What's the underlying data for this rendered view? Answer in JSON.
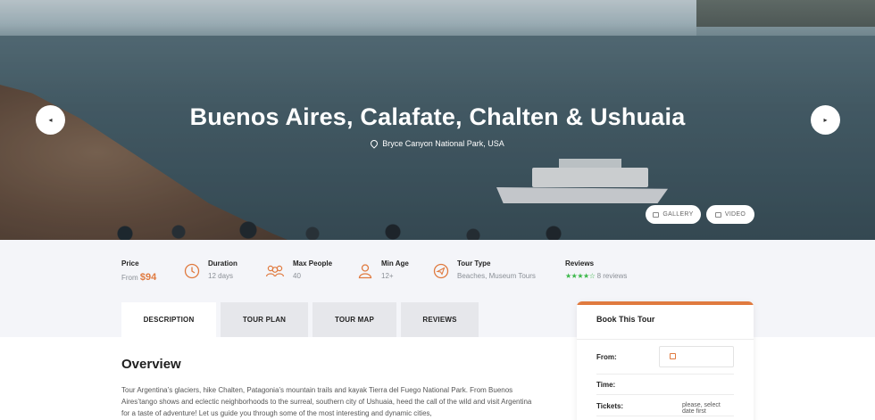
{
  "hero": {
    "title": "Buenos Aires, Calafate, Chalten & Ushuaia",
    "location": "Bryce Canyon National Park, USA",
    "prev_icon": "◂",
    "next_icon": "▸",
    "gallery_label": "GALLERY",
    "video_label": "VIDEO"
  },
  "info": {
    "price": {
      "label": "Price",
      "prefix": "From",
      "value": "$94"
    },
    "duration": {
      "label": "Duration",
      "value": "12 days",
      "icon": "clock-icon"
    },
    "max_people": {
      "label": "Max People",
      "value": "40",
      "icon": "users-icon"
    },
    "min_age": {
      "label": "Min Age",
      "value": "12+",
      "icon": "user-icon"
    },
    "tour_type": {
      "label": "Tour Type",
      "value": "Beaches, Museum Tours",
      "icon": "paper-plane-icon"
    },
    "reviews": {
      "label": "Reviews",
      "stars": "★★★★☆",
      "rating": 4,
      "count": "8 reviews"
    }
  },
  "tabs": [
    {
      "label": "DESCRIPTION",
      "active": true
    },
    {
      "label": "TOUR PLAN",
      "active": false
    },
    {
      "label": "TOUR MAP",
      "active": false
    },
    {
      "label": "REVIEWS",
      "active": false
    }
  ],
  "overview": {
    "title": "Overview",
    "text": "Tour Argentina’s glaciers, hike Chalten, Patagonia’s mountain trails and kayak Tierra del Fuego National Park. From Buenos Aires’tango shows and eclectic neighborhoods to the surreal, southern city of Ushuaia, heed the call of the wild and visit Argentina for a taste of adventure! Let us guide you through some of the most interesting and dynamic cities,"
  },
  "booking": {
    "title": "Book This Tour",
    "from_label": "From:",
    "time_label": "Time:",
    "tickets_label": "Tickets:",
    "tickets_note": "please, select date first"
  },
  "colors": {
    "accent": "#e07a3f",
    "stars": "#3cb84a",
    "info_bg": "#f4f5f9"
  }
}
